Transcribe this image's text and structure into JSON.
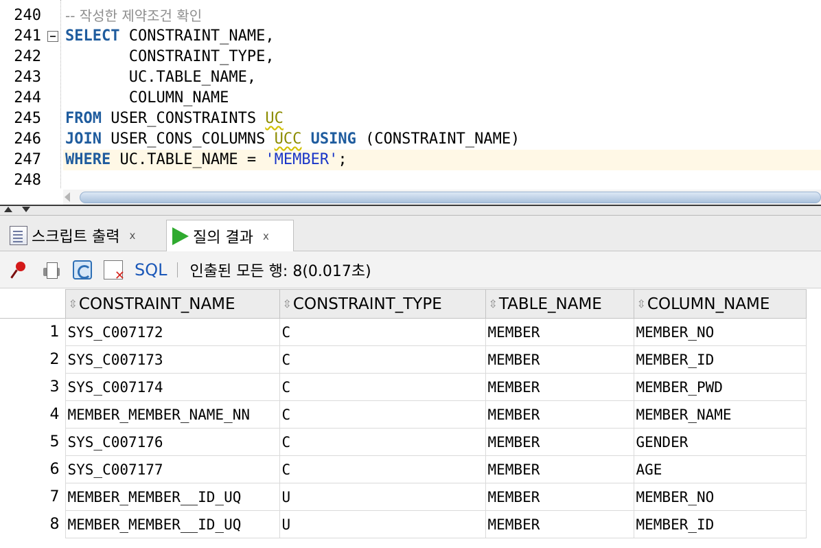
{
  "editor": {
    "line_numbers": [
      "240",
      "241",
      "242",
      "243",
      "244",
      "245",
      "246",
      "247",
      "248"
    ],
    "comment": "-- 작성한 제약조건 확인",
    "line241": {
      "kw": "SELECT",
      "rest": " CONSTRAINT_NAME,"
    },
    "line242": "       CONSTRAINT_TYPE,",
    "line243": "       UC.TABLE_NAME,",
    "line244": "       COLUMN_NAME",
    "line245": {
      "kw": "FROM",
      "rest": " USER_CONSTRAINTS ",
      "alias": "UC"
    },
    "line246": {
      "kw": "JOIN",
      "rest": " USER_CONS_COLUMNS ",
      "alias": "UCC",
      "kw2": "USING",
      "rest2": " (CONSTRAINT_NAME)"
    },
    "line247": {
      "kw": "WHERE",
      "rest": " UC.TABLE_NAME = ",
      "str": "'MEMBER'",
      "end": ";"
    }
  },
  "tabs": [
    {
      "label": "스크립트 출력",
      "close": "x",
      "icon": "script-output-icon"
    },
    {
      "label": "질의 결과",
      "close": "x",
      "icon": "run-icon"
    }
  ],
  "toolbar": {
    "sql_label": "SQL",
    "separator": "|",
    "status": "인출된 모든 행: 8(0.017초)",
    "icons": [
      "pin-icon",
      "print-icon",
      "refresh-icon",
      "cancel-fetch-icon"
    ]
  },
  "grid": {
    "columns": [
      "CONSTRAINT_NAME",
      "CONSTRAINT_TYPE",
      "TABLE_NAME",
      "COLUMN_NAME"
    ],
    "rows": [
      {
        "n": "1",
        "c": [
          "SYS_C007172",
          "C",
          "MEMBER",
          "MEMBER_NO"
        ]
      },
      {
        "n": "2",
        "c": [
          "SYS_C007173",
          "C",
          "MEMBER",
          "MEMBER_ID"
        ]
      },
      {
        "n": "3",
        "c": [
          "SYS_C007174",
          "C",
          "MEMBER",
          "MEMBER_PWD"
        ]
      },
      {
        "n": "4",
        "c": [
          "MEMBER_MEMBER_NAME_NN",
          "C",
          "MEMBER",
          "MEMBER_NAME"
        ]
      },
      {
        "n": "5",
        "c": [
          "SYS_C007176",
          "C",
          "MEMBER",
          "GENDER"
        ]
      },
      {
        "n": "6",
        "c": [
          "SYS_C007177",
          "C",
          "MEMBER",
          "AGE"
        ]
      },
      {
        "n": "7",
        "c": [
          "MEMBER_MEMBER__ID_UQ",
          "U",
          "MEMBER",
          "MEMBER_NO"
        ]
      },
      {
        "n": "8",
        "c": [
          "MEMBER_MEMBER__ID_UQ",
          "U",
          "MEMBER",
          "MEMBER_ID"
        ]
      }
    ]
  },
  "colors": {
    "keyword": "#1f5c9e",
    "alias": "#8c8c00",
    "string": "#1a36c8",
    "comment": "#8e8e8e",
    "current_line": "#fff8e6"
  }
}
